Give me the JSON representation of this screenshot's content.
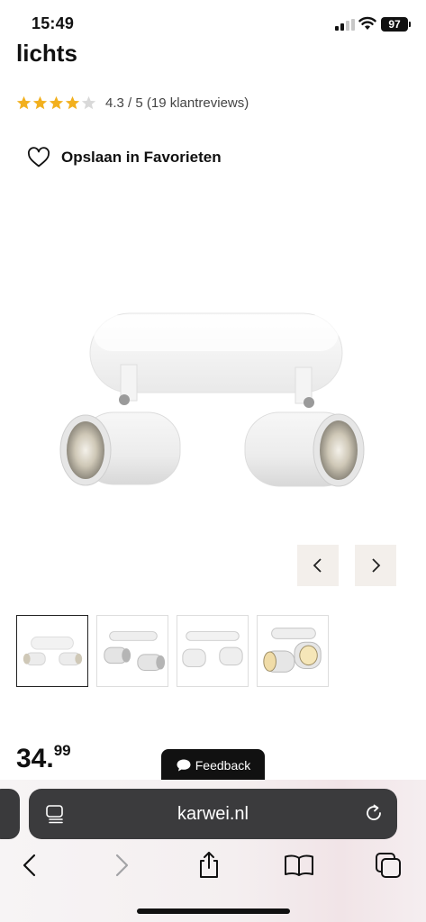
{
  "status_bar": {
    "time": "15:49",
    "battery": "97"
  },
  "product": {
    "title_partial": "lichts",
    "rating_stars": 4.3,
    "rating_text": "4.3 / 5 (19 klantreviews)",
    "favorite_label": "Opslaan in Favorieten",
    "price_whole": "34.",
    "price_cents": "99",
    "image_alt": "product-image"
  },
  "gallery": {
    "thumbnail_count": 4,
    "active_index": 0
  },
  "feedback": {
    "label": "Feedback"
  },
  "browser": {
    "url": "karwei.nl"
  },
  "colors": {
    "star": "#f2b01e",
    "star_empty": "#d9d9d9",
    "nav_bg": "#f3efeb",
    "address_bar": "#3b3b3d"
  }
}
